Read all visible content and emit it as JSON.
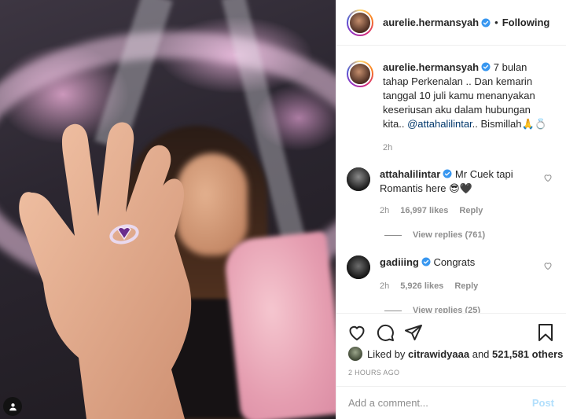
{
  "post_author": {
    "username": "aurelie.hermansyah",
    "follow_status": "Following",
    "separator": "•"
  },
  "caption": {
    "username": "aurelie.hermansyah",
    "text": "7 bulan tahap Perkenalan .. Dan kemarin tanggal 10 juli kamu menanyakan keseriusan aku dalam hubungan kita..",
    "mention": "@attahalilintar",
    "tail": ".. Bismillah🙏💍",
    "time": "2h"
  },
  "comments": [
    {
      "username": "attahalilintar",
      "text": "Mr Cuek tapi Romantis here 😎🖤",
      "time": "2h",
      "likes": "16,997 likes",
      "reply": "Reply",
      "view_replies": "View replies (761)"
    },
    {
      "username": "gadiiing",
      "text": "Congrats",
      "time": "2h",
      "likes": "5,926 likes",
      "reply": "Reply",
      "view_replies": "View replies (25)"
    }
  ],
  "likes_summary": {
    "prefix": "Liked by",
    "user": "citrawidyaaa",
    "conj": "and",
    "others": "521,581 others"
  },
  "timestamp": "2 HOURS AGO",
  "add_comment": {
    "placeholder": "Add a comment...",
    "post_label": "Post"
  },
  "colors": {
    "verified": "#3897f0",
    "link": "#00376b",
    "post_disabled": "#b2dffc"
  },
  "icons": [
    "verified-badge-icon",
    "heart-icon",
    "comment-icon",
    "share-icon",
    "bookmark-icon",
    "user-tag-icon"
  ]
}
